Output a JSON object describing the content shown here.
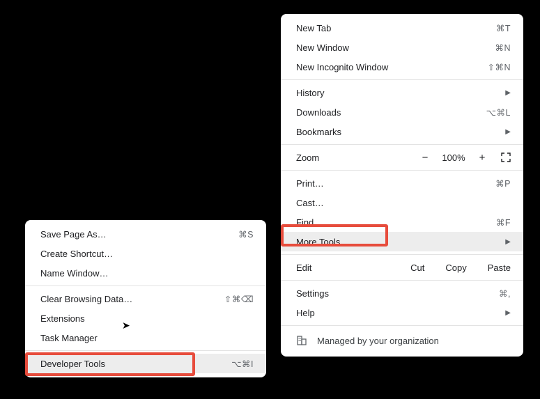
{
  "mainMenu": {
    "sections": [
      [
        {
          "label": "New Tab",
          "shortcut": "⌘T"
        },
        {
          "label": "New Window",
          "shortcut": "⌘N"
        },
        {
          "label": "New Incognito Window",
          "shortcut": "⇧⌘N"
        }
      ],
      [
        {
          "label": "History",
          "submenu": true
        },
        {
          "label": "Downloads",
          "shortcut": "⌥⌘L"
        },
        {
          "label": "Bookmarks",
          "submenu": true
        }
      ],
      [
        {
          "label": "Zoom",
          "zoom": {
            "pct": "100%"
          }
        }
      ],
      [
        {
          "label": "Print…",
          "shortcut": "⌘P"
        },
        {
          "label": "Cast…"
        },
        {
          "label": "Find…",
          "shortcut": "⌘F"
        },
        {
          "label": "More Tools",
          "submenu": true,
          "highlighted": true
        }
      ],
      [
        {
          "label": "Edit",
          "edit": [
            "Cut",
            "Copy",
            "Paste"
          ]
        }
      ],
      [
        {
          "label": "Settings",
          "shortcut": "⌘,"
        },
        {
          "label": "Help",
          "submenu": true
        }
      ]
    ],
    "managed": "Managed by your organization"
  },
  "subMenu": {
    "sections": [
      [
        {
          "label": "Save Page As…",
          "shortcut": "⌘S"
        },
        {
          "label": "Create Shortcut…"
        },
        {
          "label": "Name Window…"
        }
      ],
      [
        {
          "label": "Clear Browsing Data…",
          "shortcut": "⇧⌘⌫"
        },
        {
          "label": "Extensions"
        },
        {
          "label": "Task Manager"
        }
      ],
      [
        {
          "label": "Developer Tools",
          "shortcut": "⌥⌘I",
          "highlighted": true
        }
      ]
    ]
  }
}
